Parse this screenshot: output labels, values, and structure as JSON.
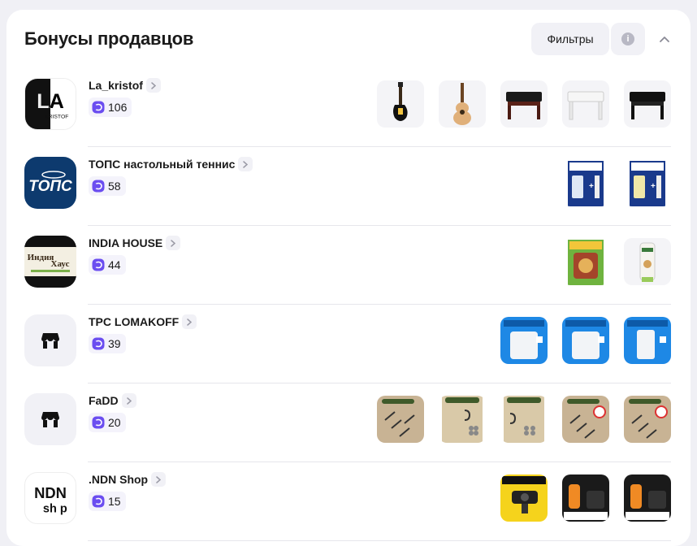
{
  "header": {
    "title": "Бонусы продавцов",
    "filters_label": "Фильтры"
  },
  "colors": {
    "bonus_icon": "#6b4ef0",
    "card_bg": "#ffffff",
    "page_bg": "#f0f0f5"
  },
  "sellers": [
    {
      "name": "La_kristof",
      "bonus": "106",
      "logo_text_main": "LA",
      "logo_text_sub": "KRISTOF",
      "products": [
        "electric-guitar",
        "acoustic-guitar",
        "piano-bench-brown",
        "piano-bench-white",
        "piano-bench-black"
      ]
    },
    {
      "name": "ТОПС настольный теннис",
      "bonus": "58",
      "logo_text_main": "ТОПС",
      "products": [
        "rubber-cleaner-pack",
        "rubber-cleaner-pack"
      ]
    },
    {
      "name": "INDIA HOUSE",
      "bonus": "44",
      "logo_text_main": "Индия",
      "logo_text_sub": "Хаус",
      "products": [
        "tea-box",
        "cream-tube"
      ]
    },
    {
      "name": "TPC LOMAKOFF",
      "bonus": "39",
      "products": [
        "primer-bag-10l",
        "primer-bag-5l",
        "primer-bottle-1l"
      ]
    },
    {
      "name": "FaDD",
      "bonus": "20",
      "products": [
        "screws-pack",
        "hooks-pack",
        "hooks-pack",
        "screws-pack",
        "screws-pack"
      ]
    },
    {
      "name": ".NDN Shop",
      "bonus": "15",
      "logo_text_main": "NDN",
      "logo_text_sub": "sh p",
      "products": [
        "webcam-box",
        "smart-scale",
        "smart-scale"
      ]
    }
  ]
}
